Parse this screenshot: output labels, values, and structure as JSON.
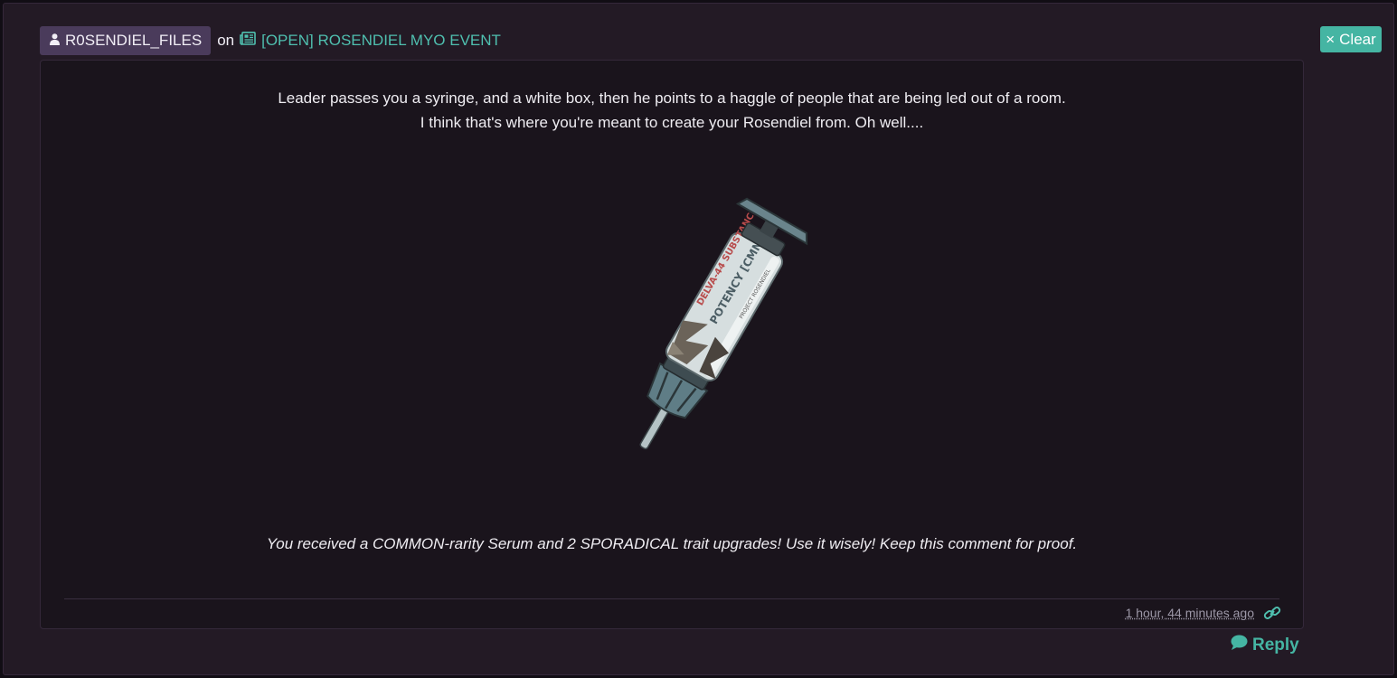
{
  "header": {
    "username": "R0SENDIEL_FILES",
    "on_word": "on",
    "thread_title": "[OPEN] ROSENDIEL MYO EVENT"
  },
  "clear_button": {
    "label": "Clear"
  },
  "comment": {
    "line1": "Leader passes you a syringe, and a white box, then he points to a haggle of people that are being led out of a room.",
    "line2": "I think that's where you're meant to create your Rosendiel from. Oh well....",
    "image": {
      "label_top": "DELVA-44 SUBSTANCE",
      "label_main": "POTENCY [CMN]",
      "label_side": "PROJECT ROSENDIEL"
    },
    "result_text": "You received a COMMON-rarity Serum and 2 SPORADICAL trait upgrades! Use it wisely! Keep this comment for proof.",
    "timestamp": "1 hour, 44 minutes ago"
  },
  "reply_button": {
    "label": "Reply"
  },
  "colors": {
    "accent": "#45b5a3",
    "link": "#4fbfaf",
    "user_chip": "#4a3b5b",
    "panel_bg": "#1a141c"
  },
  "icons": {
    "user": "user-icon",
    "thread": "newspaper-icon",
    "clear": "times-icon",
    "permalink": "link-icon",
    "reply": "comment-icon"
  }
}
